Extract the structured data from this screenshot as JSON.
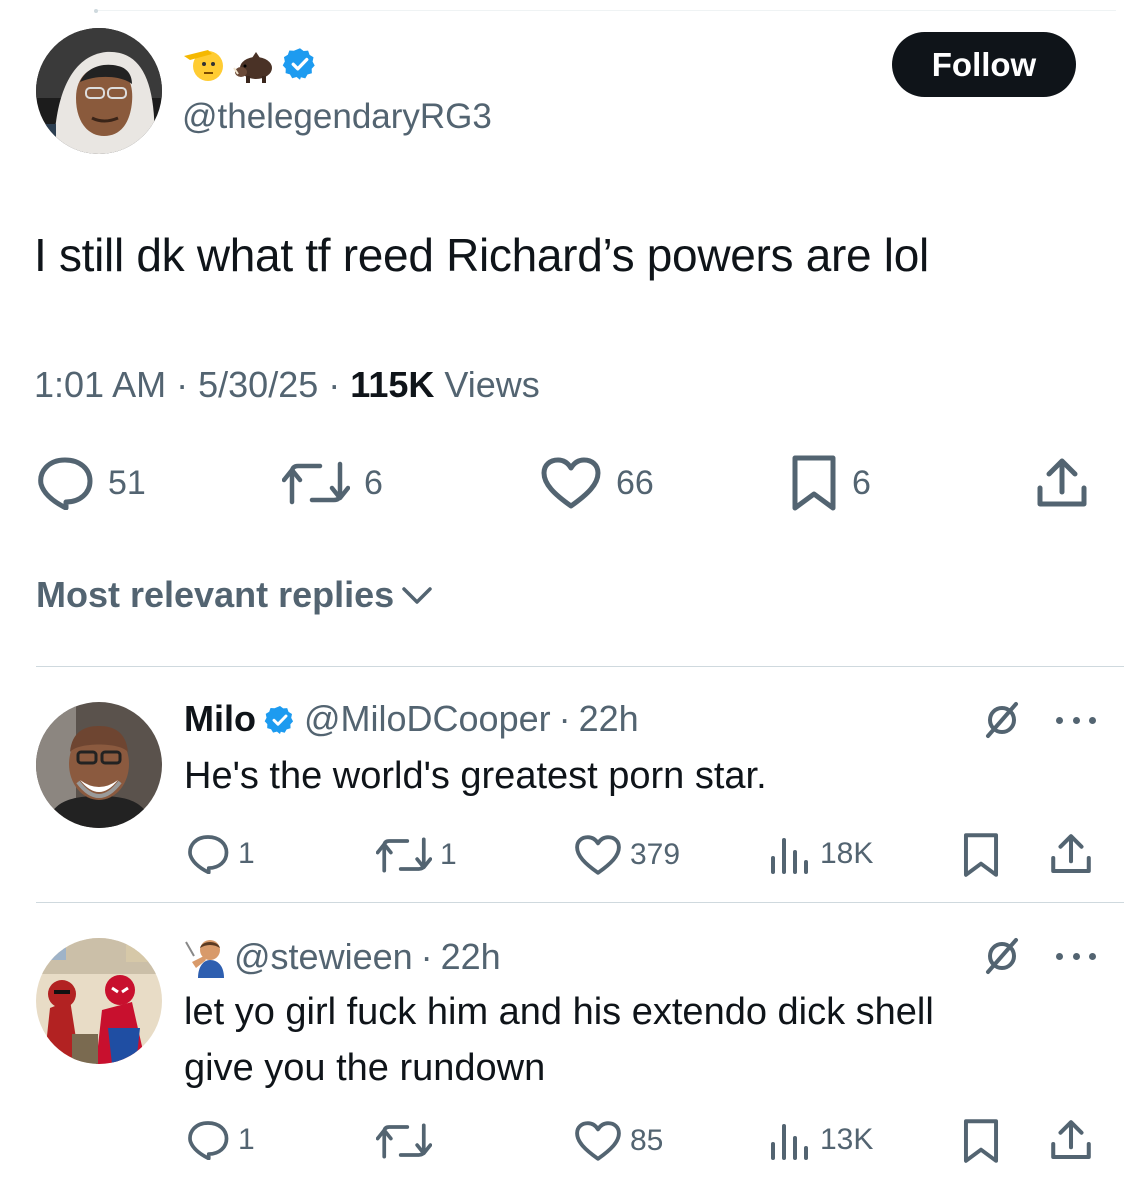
{
  "main_tweet": {
    "handle": "@thelegendaryRG3",
    "text": "I still dk what tf reed Richard’s powers are lol",
    "time": "1:01 AM",
    "date": "5/30/25",
    "views_count": "115K",
    "views_label": "Views",
    "separator": "·",
    "follow_label": "Follow",
    "name_emojis": [
      "saluting-face-icon",
      "boar-icon"
    ],
    "stats": {
      "replies": "51",
      "reposts": "6",
      "likes": "66",
      "bookmarks": "6"
    }
  },
  "sort": {
    "label": "Most relevant replies"
  },
  "replies": [
    {
      "name": "Milo",
      "handle": "@MiloDCooper",
      "time": "22h",
      "text": "He's the world's greatest porn star.",
      "stats": {
        "replies": "1",
        "reposts": "1",
        "likes": "379",
        "views": "18K"
      }
    },
    {
      "name_emoji": "man-shushing-icon",
      "handle": "@stewieen",
      "time": "22h",
      "text_line1": "let yo girl fuck him and his extendo dick shell",
      "text_line2": "give you the rundown",
      "stats": {
        "replies": "1",
        "reposts": "",
        "likes": "85",
        "views": "13K"
      }
    }
  ],
  "colors": {
    "text": "#0f1419",
    "secondary": "#536471",
    "verified": "#1d9bf0",
    "follow_bg": "#0f1419"
  }
}
